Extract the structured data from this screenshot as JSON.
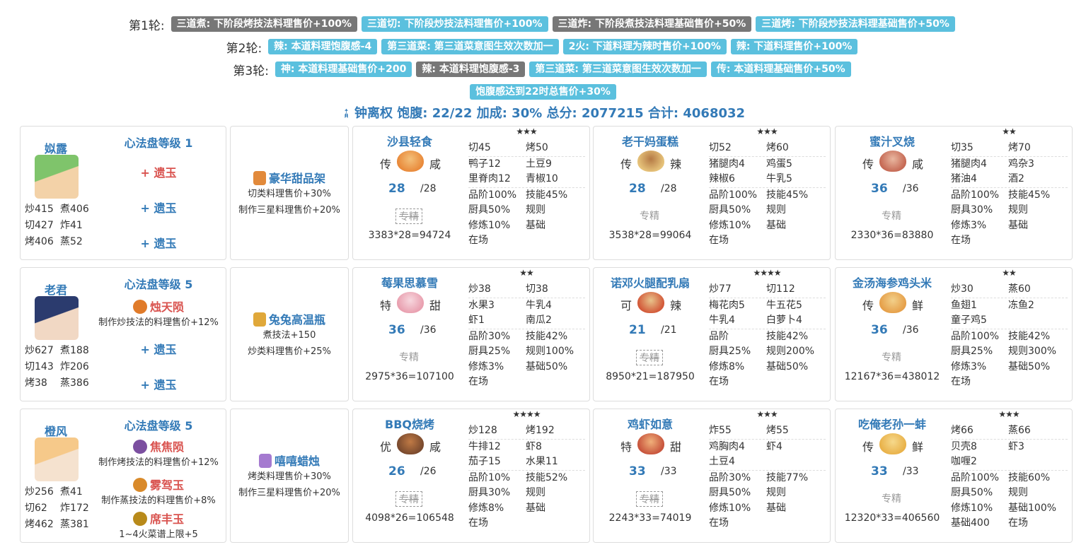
{
  "rounds": [
    {
      "label": "第1轮:",
      "tags": [
        {
          "text": "三道煮: 下阶段烤技法料理售价+100%",
          "color": "gray"
        },
        {
          "text": "三道切: 下阶段炒技法料理售价+100%",
          "color": "blue"
        },
        {
          "text": "三道炸: 下阶段煮技法料理基础售价+50%",
          "color": "gray"
        },
        {
          "text": "三道烤: 下阶段炒技法料理基础售价+50%",
          "color": "blue"
        }
      ]
    },
    {
      "label": "第2轮:",
      "tags": [
        {
          "text": "辣: 本道料理饱腹感-4",
          "color": "blue"
        },
        {
          "text": "第三道菜: 第三道菜意图生效次数加一",
          "color": "blue"
        },
        {
          "text": "2火: 下道料理为辣时售价+100%",
          "color": "blue"
        },
        {
          "text": "辣: 下道料理售价+100%",
          "color": "blue"
        }
      ]
    },
    {
      "label": "第3轮:",
      "tags": [
        {
          "text": "神: 本道料理基础售价+200",
          "color": "blue"
        },
        {
          "text": "辣: 本道料理饱腹感-3",
          "color": "gray"
        },
        {
          "text": "第三道菜: 第三道菜意图生效次数加一",
          "color": "blue"
        },
        {
          "text": "传: 本道料理基础售价+50%",
          "color": "blue"
        }
      ]
    },
    {
      "label": "",
      "tags": [
        {
          "text": "饱腹感达到22时总售价+30%",
          "color": "blue"
        }
      ]
    }
  ],
  "summary": "钟离权 饱腹: 22/22 加成: 30% 总分: 2077215 合计: 4068032",
  "chefs": [
    {
      "name": "姒露",
      "level": "心法盘等级 1",
      "stats": [
        "炒415",
        "煮406",
        "切427",
        "炸41",
        "烤406",
        "蒸52"
      ],
      "jades": [
        {
          "text": "+ 遗玉",
          "color": "red",
          "desc": ""
        },
        {
          "text": "+ 遗玉",
          "color": "blue",
          "desc": ""
        },
        {
          "text": "+ 遗玉",
          "color": "blue",
          "desc": ""
        }
      ],
      "equip": {
        "name": "豪华甜品架",
        "desc": [
          "切类料理售价+30%",
          "制作三星料理售价+20%"
        ]
      },
      "recipes": [
        {
          "name": "沙县轻食",
          "rarity": "传",
          "taste": "咸",
          "qty": "28",
          "max": "/28",
          "spec": "专精",
          "specBox": true,
          "calc": "3383*28=94724",
          "stars": "★★★",
          "skills": [
            "切45",
            "烤50"
          ],
          "mats": [
            "鸭子12",
            "土豆9",
            "里脊肉12",
            "青椒10"
          ],
          "info": [
            "品阶100%",
            "技能45%",
            "厨具50%",
            "规则",
            "修炼10%",
            "基础",
            "在场",
            ""
          ]
        },
        {
          "name": "老干妈蛋糕",
          "rarity": "传",
          "taste": "辣",
          "qty": "28",
          "max": "/28",
          "spec": "专精",
          "specBox": false,
          "calc": "3538*28=99064",
          "stars": "★★★",
          "skills": [
            "切52",
            "烤60"
          ],
          "mats": [
            "猪腿肉4",
            "鸡蛋5",
            "辣椒6",
            "牛乳5"
          ],
          "info": [
            "品阶100%",
            "技能45%",
            "厨具50%",
            "规则",
            "修炼10%",
            "基础",
            "在场",
            ""
          ]
        },
        {
          "name": "蜜汁叉烧",
          "rarity": "传",
          "taste": "咸",
          "qty": "36",
          "max": "/36",
          "spec": "专精",
          "specBox": false,
          "calc": "2330*36=83880",
          "stars": "★★",
          "skills": [
            "切35",
            "烤70"
          ],
          "mats": [
            "猪腿肉4",
            "鸡杂3",
            "猪油4",
            "酒2"
          ],
          "info": [
            "品阶100%",
            "技能45%",
            "厨具30%",
            "规则",
            "修炼3%",
            "基础",
            "在场",
            ""
          ]
        }
      ]
    },
    {
      "name": "老君",
      "level": "心法盘等级 5",
      "stats": [
        "炒627",
        "煮188",
        "切143",
        "炸206",
        "烤38",
        "蒸386"
      ],
      "jades": [
        {
          "text": "烛天陨",
          "color": "red",
          "desc": "制作炒技法的料理售价+12%"
        },
        {
          "text": "+ 遗玉",
          "color": "blue",
          "desc": ""
        },
        {
          "text": "+ 遗玉",
          "color": "blue",
          "desc": ""
        }
      ],
      "equip": {
        "name": "兔兔高温瓶",
        "desc": [
          "煮技法+150",
          "炒类料理售价+25%"
        ]
      },
      "recipes": [
        {
          "name": "莓果思慕雪",
          "rarity": "特",
          "taste": "甜",
          "qty": "36",
          "max": "/36",
          "spec": "专精",
          "specBox": false,
          "calc": "2975*36=107100",
          "stars": "★★",
          "skills": [
            "炒38",
            "切38"
          ],
          "mats": [
            "水果3",
            "牛乳4",
            "虾1",
            "南瓜2"
          ],
          "info": [
            "品阶30%",
            "技能42%",
            "厨具25%",
            "规则100%",
            "修炼3%",
            "基础50%",
            "在场",
            ""
          ]
        },
        {
          "name": "诺邓火腿配乳扇",
          "rarity": "可",
          "taste": "辣",
          "qty": "21",
          "max": "/21",
          "spec": "专精",
          "specBox": true,
          "calc": "8950*21=187950",
          "stars": "★★★★",
          "skills": [
            "炒77",
            "切112"
          ],
          "mats": [
            "梅花肉5",
            "牛五花5",
            "牛乳4",
            "白萝卜4"
          ],
          "info": [
            "品阶",
            "技能42%",
            "厨具25%",
            "规则200%",
            "修炼8%",
            "基础50%",
            "在场",
            ""
          ]
        },
        {
          "name": "金汤海参鸡头米",
          "rarity": "传",
          "taste": "鲜",
          "qty": "36",
          "max": "/36",
          "spec": "专精",
          "specBox": false,
          "calc": "12167*36=438012",
          "stars": "★★",
          "skills": [
            "炒30",
            "蒸60"
          ],
          "mats": [
            "鱼翅1",
            "冻鱼2",
            "童子鸡5",
            ""
          ],
          "info": [
            "品阶100%",
            "技能42%",
            "厨具25%",
            "规则300%",
            "修炼3%",
            "基础50%",
            "在场",
            ""
          ]
        }
      ]
    },
    {
      "name": "橙风",
      "level": "心法盘等级 5",
      "stats": [
        "炒256",
        "煮41",
        "切62",
        "炸172",
        "烤462",
        "蒸381"
      ],
      "jades": [
        {
          "text": "焦焦陨",
          "color": "red",
          "desc": "制作烤技法的料理售价+12%"
        },
        {
          "text": "雾驾玉",
          "color": "red",
          "desc": "制作蒸技法的料理售价+8%"
        },
        {
          "text": "席丰玉",
          "color": "red",
          "desc": "1~4火菜谱上限+5"
        }
      ],
      "equip": {
        "name": "嘻嘻蜡烛",
        "desc": [
          "烤类料理售价+30%",
          "制作三星料理售价+20%"
        ]
      },
      "recipes": [
        {
          "name": "BBQ烧烤",
          "rarity": "优",
          "taste": "咸",
          "qty": "26",
          "max": "/26",
          "spec": "专精",
          "specBox": true,
          "calc": "4098*26=106548",
          "stars": "★★★★",
          "skills": [
            "炒128",
            "烤192"
          ],
          "mats": [
            "牛排12",
            "虾8",
            "茄子15",
            "水果11"
          ],
          "info": [
            "品阶10%",
            "技能52%",
            "厨具30%",
            "规则",
            "修炼8%",
            "基础",
            "在场",
            ""
          ]
        },
        {
          "name": "鸡虾如意",
          "rarity": "特",
          "taste": "甜",
          "qty": "33",
          "max": "/33",
          "spec": "专精",
          "specBox": true,
          "calc": "2243*33=74019",
          "stars": "★★★",
          "skills": [
            "炸55",
            "烤55"
          ],
          "mats": [
            "鸡胸肉4",
            "虾4",
            "土豆4",
            ""
          ],
          "info": [
            "品阶30%",
            "技能77%",
            "厨具50%",
            "规则",
            "修炼10%",
            "基础",
            "在场",
            ""
          ]
        },
        {
          "name": "吃俺老孙一蚌",
          "rarity": "传",
          "taste": "鲜",
          "qty": "33",
          "max": "/33",
          "spec": "专精",
          "specBox": false,
          "calc": "12320*33=406560",
          "stars": "★★★",
          "skills": [
            "烤66",
            "蒸66"
          ],
          "mats": [
            "贝壳8",
            "虾3",
            "咖喱2",
            ""
          ],
          "info": [
            "品阶100%",
            "技能60%",
            "厨具50%",
            "规则",
            "修炼10%",
            "基础100%",
            "基础400",
            "在场"
          ]
        }
      ]
    }
  ]
}
